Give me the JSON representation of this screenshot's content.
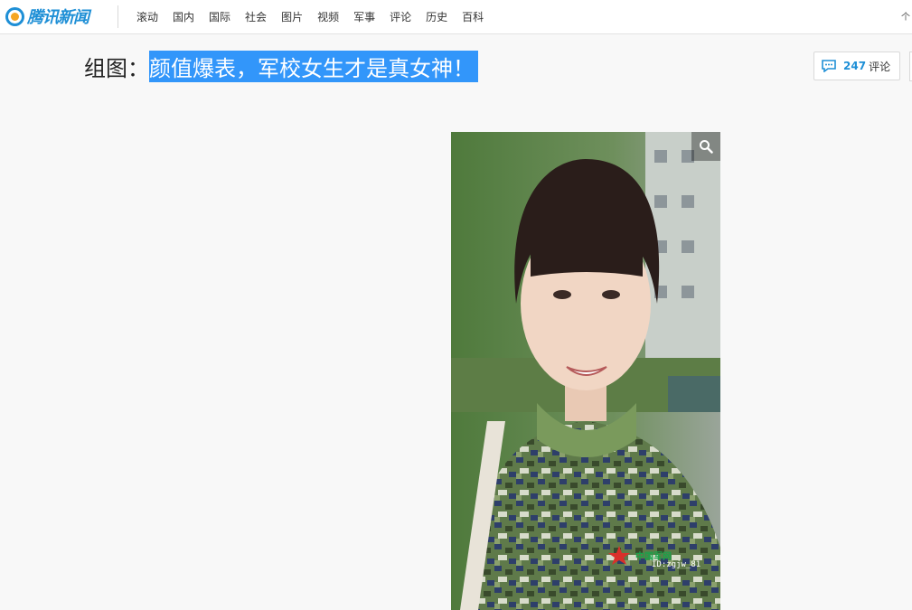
{
  "header": {
    "logo_text": "腾讯新闻",
    "nav": [
      "滚动",
      "国内",
      "国际",
      "社会",
      "图片",
      "视频",
      "军事",
      "评论",
      "历史",
      "百科"
    ],
    "corner": "个"
  },
  "article": {
    "title_prefix": "组图：",
    "title_main": "颜值爆表，军校女生才是真女神！"
  },
  "comments": {
    "count": "247",
    "label": "评论"
  },
  "photo": {
    "watermark_id": "ID:zgjw_81",
    "watermark_brand": "中国军网",
    "zoom_icon": "magnifier-icon"
  },
  "colors": {
    "brand_blue": "#1e8fd6",
    "title_highlight": "#3296fa",
    "page_bg": "#f8f8f8"
  }
}
